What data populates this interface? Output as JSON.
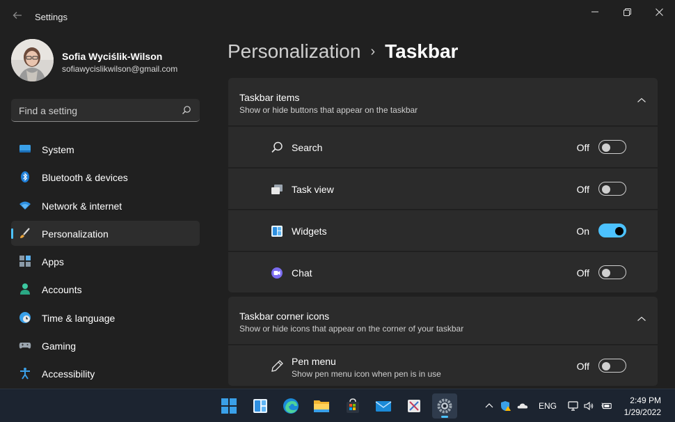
{
  "window": {
    "title": "Settings"
  },
  "profile": {
    "name": "Sofia Wyciślik-Wilson",
    "email": "sofiawycislikwilson@gmail.com"
  },
  "search": {
    "placeholder": "Find a setting"
  },
  "sidebar": {
    "items": [
      {
        "label": "System",
        "icon": "system-icon"
      },
      {
        "label": "Bluetooth & devices",
        "icon": "bluetooth-icon"
      },
      {
        "label": "Network & internet",
        "icon": "wifi-icon"
      },
      {
        "label": "Personalization",
        "icon": "brush-icon",
        "active": true
      },
      {
        "label": "Apps",
        "icon": "apps-icon"
      },
      {
        "label": "Accounts",
        "icon": "person-icon"
      },
      {
        "label": "Time & language",
        "icon": "clock-globe-icon"
      },
      {
        "label": "Gaming",
        "icon": "gamepad-icon"
      },
      {
        "label": "Accessibility",
        "icon": "accessibility-icon"
      }
    ]
  },
  "breadcrumb": {
    "parent": "Personalization",
    "separator": "›",
    "current": "Taskbar"
  },
  "groups": {
    "taskbar_items": {
      "title": "Taskbar items",
      "subtitle": "Show or hide buttons that appear on the taskbar",
      "rows": [
        {
          "label": "Search",
          "state": "Off",
          "on": false,
          "icon": "search-icon"
        },
        {
          "label": "Task view",
          "state": "Off",
          "on": false,
          "icon": "task-view-icon"
        },
        {
          "label": "Widgets",
          "state": "On",
          "on": true,
          "icon": "widgets-icon"
        },
        {
          "label": "Chat",
          "state": "Off",
          "on": false,
          "icon": "chat-icon"
        }
      ]
    },
    "corner_icons": {
      "title": "Taskbar corner icons",
      "subtitle": "Show or hide icons that appear on the corner of your taskbar",
      "rows": [
        {
          "label": "Pen menu",
          "sub": "Show pen menu icon when pen is in use",
          "state": "Off",
          "on": false,
          "icon": "pen-icon"
        }
      ]
    }
  },
  "taskbar": {
    "apps": [
      "start-icon",
      "widgets-icon",
      "edge-icon",
      "file-explorer-icon",
      "store-icon",
      "mail-icon",
      "snip-icon",
      "settings-icon"
    ],
    "language": "ENG",
    "time": "2:49 PM",
    "date": "1/29/2022"
  },
  "colors": {
    "accent": "#4cc2ff",
    "background": "#202020",
    "card": "#2b2b2b",
    "taskbar": "#1c2430"
  }
}
